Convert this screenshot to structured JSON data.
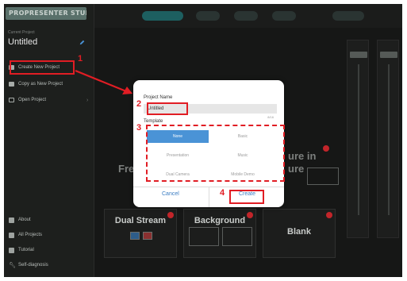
{
  "app": {
    "logo_text": "PROPRESENTER STUDIO"
  },
  "sidebar": {
    "current_label": "Current Project",
    "project_title": "Untitled",
    "items": [
      {
        "label": "Create New Project",
        "icon": "new-project-icon"
      },
      {
        "label": "Copy as New Project",
        "icon": "copy-icon"
      },
      {
        "label": "Open Project",
        "icon": "folder-icon"
      }
    ],
    "bottom_items": [
      {
        "label": "About",
        "icon": "info-icon"
      },
      {
        "label": "All Projects",
        "icon": "projects-icon"
      },
      {
        "label": "Tutorial",
        "icon": "tutorial-icon"
      },
      {
        "label": "Self-diagnosis",
        "icon": "wrench-icon"
      }
    ]
  },
  "background": {
    "partial_left": "Free",
    "partial_right_line1": "ure in",
    "partial_right_line2": "ure",
    "cards": [
      {
        "title": "Dual Stream"
      },
      {
        "title": "Background"
      },
      {
        "title": "Blank"
      }
    ]
  },
  "dialog": {
    "project_name_label": "Project Name",
    "project_name_value": "Untitled",
    "char_counter": "8/16",
    "template_label": "Template",
    "templates": [
      {
        "label": "None",
        "selected": true
      },
      {
        "label": "Basic",
        "selected": false
      },
      {
        "label": "Presentation",
        "selected": false
      },
      {
        "label": "Music",
        "selected": false
      },
      {
        "label": "Dual Camera",
        "selected": false
      },
      {
        "label": "Mobile Demo",
        "selected": false
      }
    ],
    "cancel_label": "Cancel",
    "create_label": "Create"
  },
  "annotations": {
    "step1": "1",
    "step2": "2",
    "step3": "3",
    "step4": "4",
    "color": "#e11d24"
  },
  "colors": {
    "accent_blue": "#4a93d6",
    "highlight_red": "#e11d24"
  }
}
